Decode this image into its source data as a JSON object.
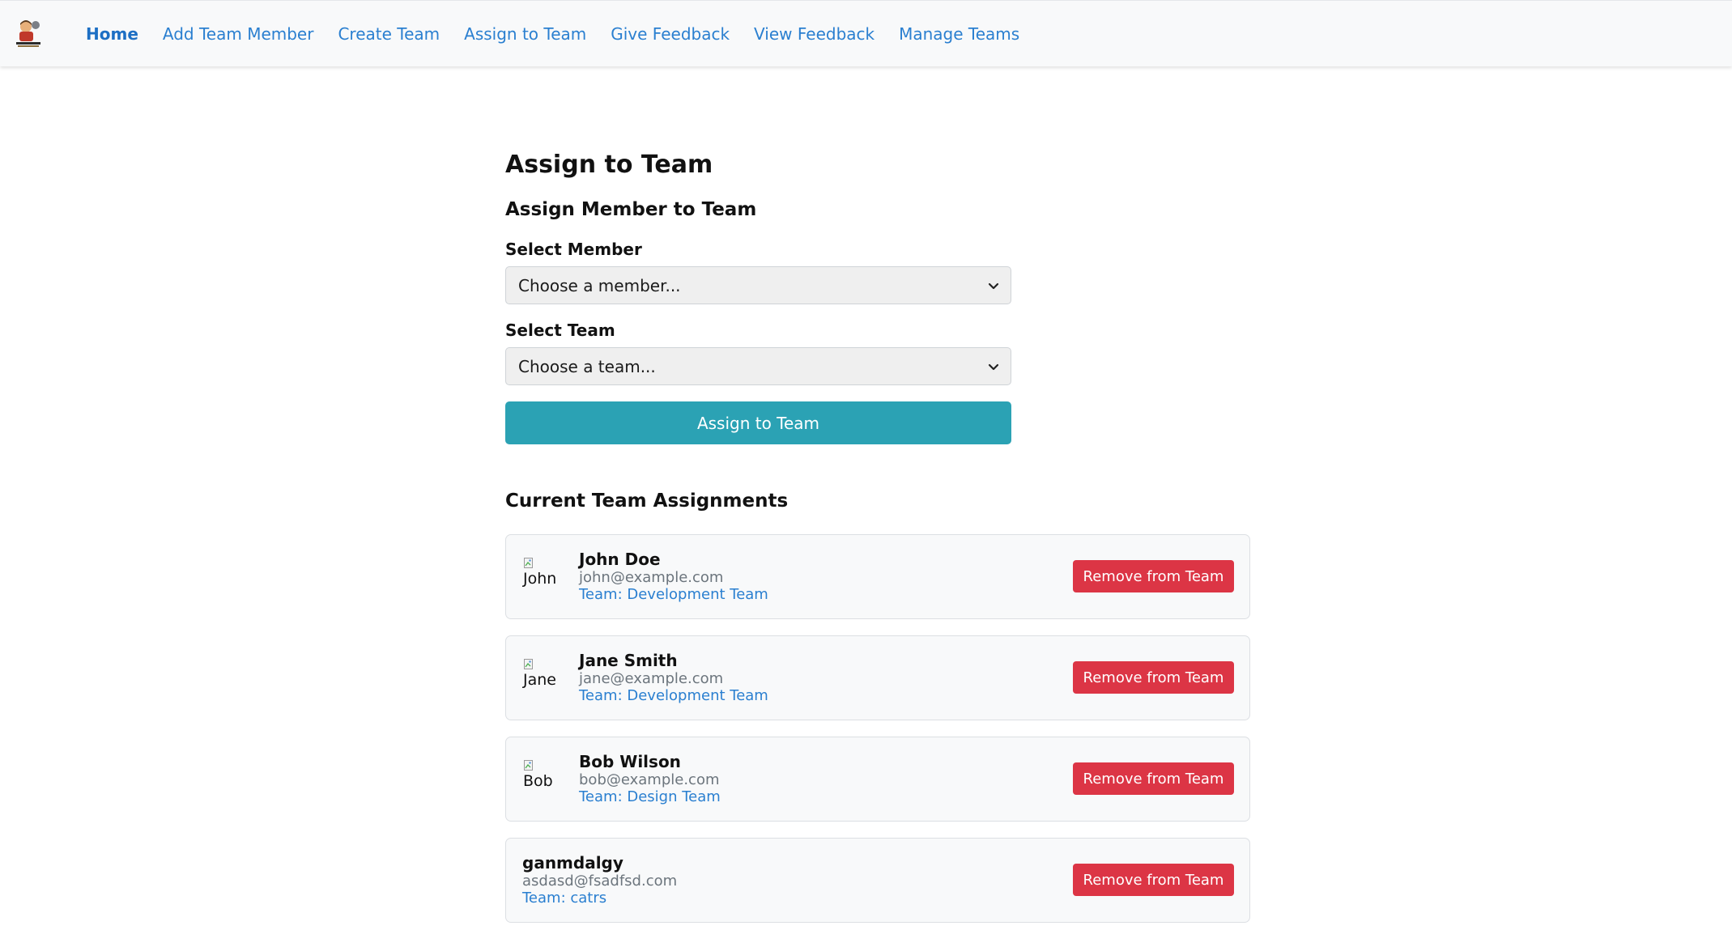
{
  "nav": {
    "items": [
      {
        "label": "Home",
        "active": true
      },
      {
        "label": "Add Team Member"
      },
      {
        "label": "Create Team"
      },
      {
        "label": "Assign to Team"
      },
      {
        "label": "Give Feedback"
      },
      {
        "label": "View Feedback"
      },
      {
        "label": "Manage Teams"
      }
    ],
    "logo_icon": "cartoon-person-logo-icon"
  },
  "page": {
    "title": "Assign to Team",
    "form_title": "Assign Member to Team",
    "member_label": "Select Member",
    "member_value": "Choose a member...",
    "team_label": "Select Team",
    "team_value": "Choose a team...",
    "submit_label": "Assign to Team"
  },
  "assignments": {
    "heading": "Current Team Assignments",
    "members": [
      {
        "name": "John Doe",
        "email": "john@example.com",
        "team": "Team: Development Team",
        "avatar_alt": "John",
        "has_avatar": true
      },
      {
        "name": "Jane Smith",
        "email": "jane@example.com",
        "team": "Team: Development Team",
        "avatar_alt": "Jane",
        "has_avatar": true
      },
      {
        "name": "Bob Wilson",
        "email": "bob@example.com",
        "team": "Team: Design Team",
        "avatar_alt": "Bob",
        "has_avatar": true
      },
      {
        "name": "ganmdalgy",
        "email": "asdasd@fsadfsd.com",
        "team": "Team: catrs",
        "has_avatar": false
      }
    ],
    "remove_label": "Remove from Team"
  },
  "colors": {
    "nav_link": "#2a7fd0",
    "primary_button": "#2ba2b4",
    "danger_button": "#dc3545",
    "team_text": "#2a7fd0"
  }
}
